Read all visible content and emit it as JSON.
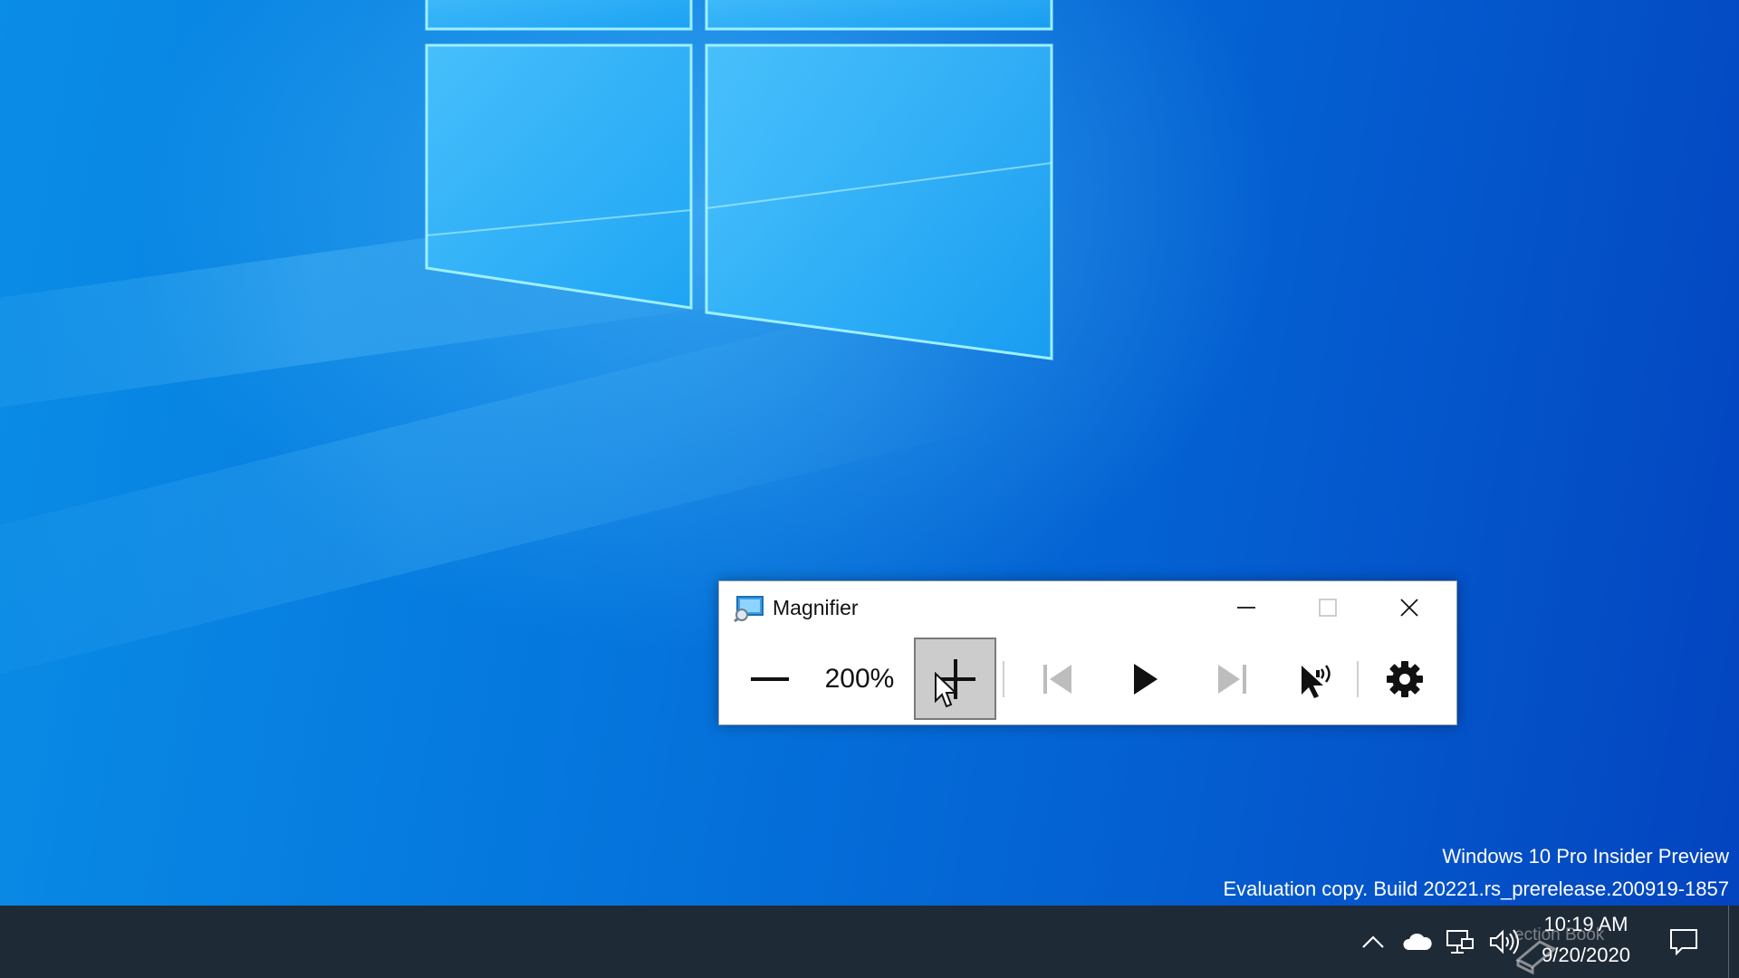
{
  "desktop": {
    "watermark_line1": "Windows 10 Pro Insider Preview",
    "watermark_line2": "Evaluation copy. Build 20221.rs_prerelease.200919-1857"
  },
  "magnifier": {
    "title": "Magnifier",
    "zoom_level": "200%",
    "controls": {
      "zoom_out": "minus-icon",
      "zoom_in": "plus-icon",
      "previous": "skip-previous-icon",
      "play": "play-icon",
      "next": "skip-next-icon",
      "read_from_here": "mouse-pointer-speaker-icon",
      "settings": "gear-icon"
    }
  },
  "taskbar": {
    "tray_icons": [
      "chevron-up-icon",
      "onedrive-cloud-icon",
      "network-icon",
      "volume-icon"
    ],
    "time": "10:19 AM",
    "date": "9/20/2020",
    "overlay_text": "ection Book",
    "notification_icon": "action-center-icon"
  },
  "colors": {
    "desktop_accent": "#0578de",
    "taskbar": "#1f2a37",
    "zoom_in_pressed": "#cccccc"
  }
}
